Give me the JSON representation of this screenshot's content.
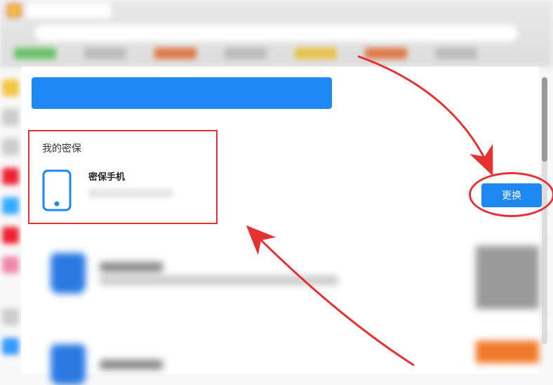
{
  "security_section": {
    "title": "我的密保",
    "phone_label": "密保手机"
  },
  "change_button": {
    "label": "更换"
  },
  "colors": {
    "accent": "#1e88f2",
    "annotation": "#e63232"
  }
}
